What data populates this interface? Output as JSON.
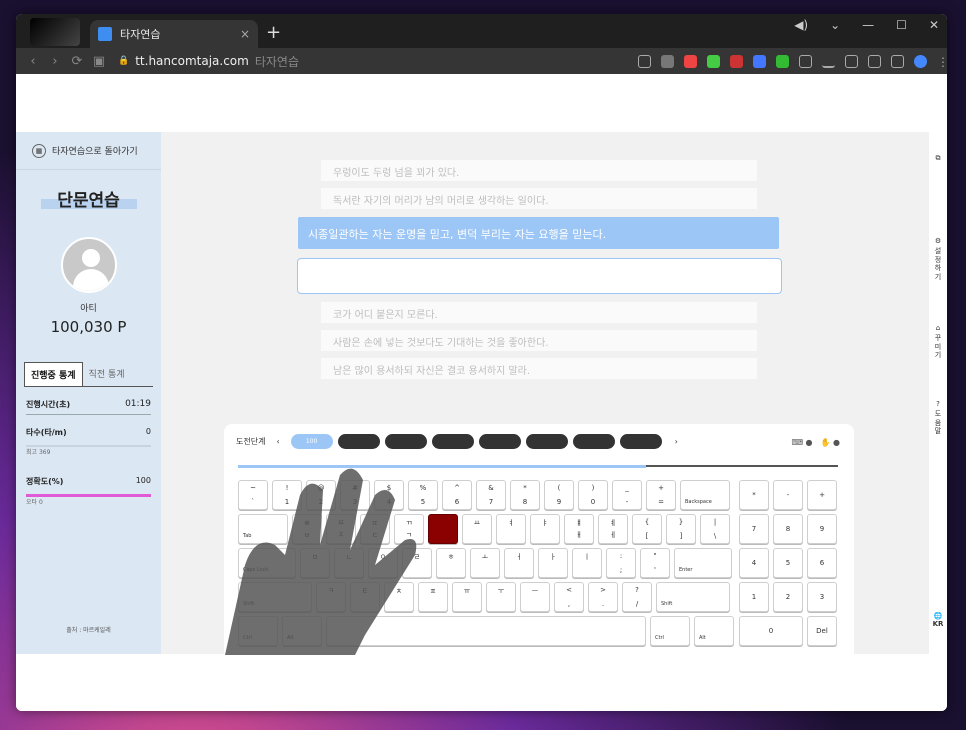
{
  "browser": {
    "tab_title": "타자연습",
    "tab_close": "×",
    "new_tab": "+",
    "url_domain": "tt.hancomtaja.com",
    "url_title": "타자연습",
    "nav_back": "‹",
    "nav_forward": "›",
    "nav_reload": "⟳",
    "lock": "🔒"
  },
  "sidebar": {
    "back_label": "타자연습으로 돌아가기",
    "mode_title": "단문연습",
    "username": "아티",
    "points": "100,030 P",
    "tabs": [
      "진행중 통계",
      "직전 통계"
    ],
    "stats": {
      "time_label": "진행시간(초)",
      "time_value": "01:19",
      "speed_label": "타수(타/m)",
      "speed_value": "0",
      "speed_sub": "최고 369",
      "accuracy_label": "정확도(%)",
      "accuracy_value": "100",
      "accuracy_sub": "오타 0"
    },
    "credit": "출처 : 마르케일레"
  },
  "sentences": {
    "prev": [
      "우렁이도 두렁 넘을 꾀가 있다.",
      "독서란 자기의 머리가 남의 머리로 생각하는 일이다."
    ],
    "current": "시종일관하는 자는 운명을 믿고, 변덕 부리는 자는 요행을 믿는다.",
    "next": [
      "코가 어디 붙은지 모른다.",
      "사람은 손에 넣는 것보다도 기대하는 것을 좋아한다.",
      "남은 많이 용서하되 자신은 결코 용서하지 말라."
    ]
  },
  "keyboard": {
    "level_label": "도전단계",
    "level_prev": "‹",
    "level_next": "›",
    "levels": [
      "100",
      "",
      "",
      "",
      "",
      "",
      "",
      ""
    ],
    "progress": 0.68
  },
  "rail": {
    "copy_icon": "⧉",
    "settings": "설정하기",
    "decorate": "꾸미기",
    "help": "도움말",
    "lang": "KR"
  },
  "colors": {
    "accent": "#9cc6f5",
    "highlight_key": "#8b0000",
    "accuracy_bar": "#e05ad8"
  }
}
